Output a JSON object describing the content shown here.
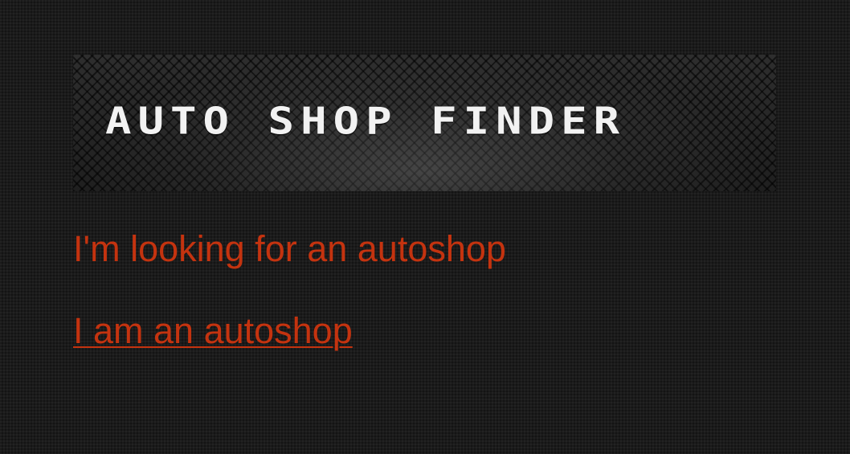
{
  "header": {
    "logo_text": "AUTO SHOP FINDER"
  },
  "options": {
    "looking_text": "I'm looking for an autoshop",
    "autoshop_link": "I am an autoshop"
  },
  "colors": {
    "background": "#1b1b1b",
    "accent": "#c4330f",
    "logo_text": "#f2f2f2"
  }
}
